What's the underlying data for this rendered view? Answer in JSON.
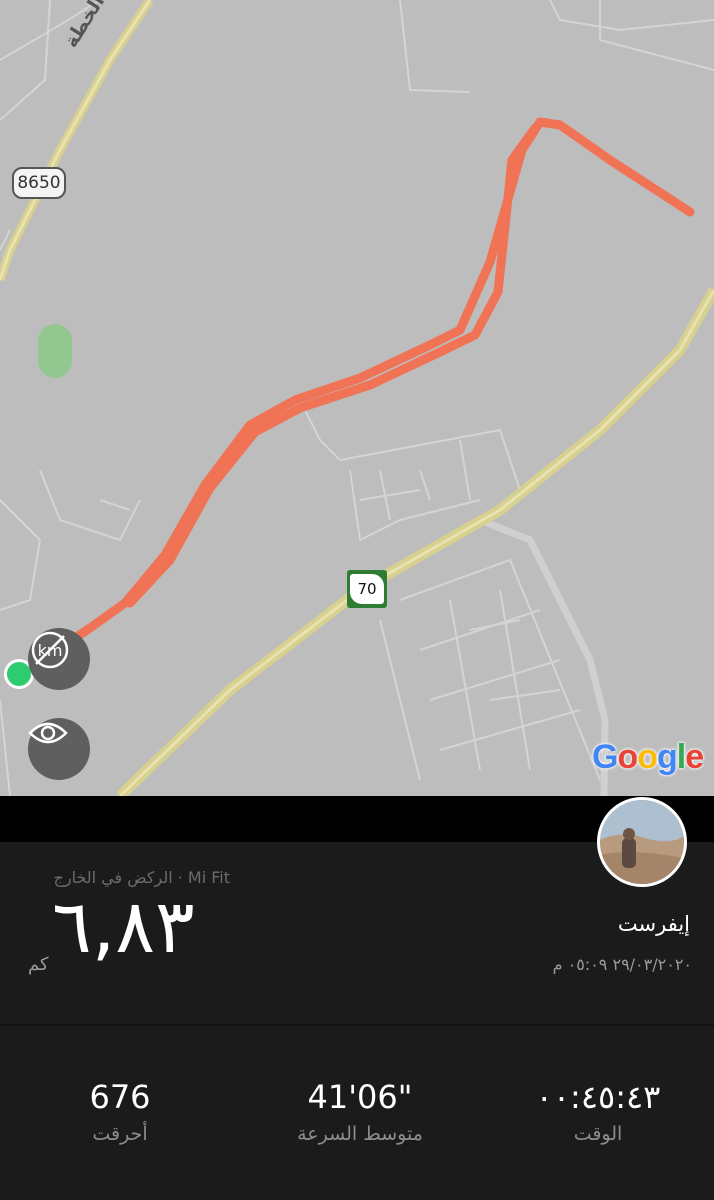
{
  "map": {
    "road_label": "طريق الخطة",
    "route_number": "8650",
    "highway_number": "70",
    "google_logo": [
      "G",
      "o",
      "o",
      "g",
      "l",
      "e"
    ],
    "google_colors": [
      "#4285F4",
      "#EA4335",
      "#FBBC05",
      "#4285F4",
      "#34A853",
      "#EA4335"
    ],
    "route_color": "#f07355",
    "start_color": "#2ecc71",
    "units_toggle_icon": "km-crossed-icon",
    "visibility_icon": "eye-icon"
  },
  "summary": {
    "source_line": "الركض في الخارج · Mi Fit",
    "distance_value": "٦,٨٣",
    "distance_unit": "كم",
    "username": "إيفرست",
    "datetime": "٢٩/٠٣/٢٠٢٠ ٠٥:٠٩ م"
  },
  "stats": {
    "calories_value": "676",
    "calories_label": "أحرقت",
    "pace_value": "41'06\"",
    "pace_label": "متوسط السرعة",
    "duration_value": "٠٠:٤٥:٤٣",
    "duration_label": "الوقت"
  }
}
